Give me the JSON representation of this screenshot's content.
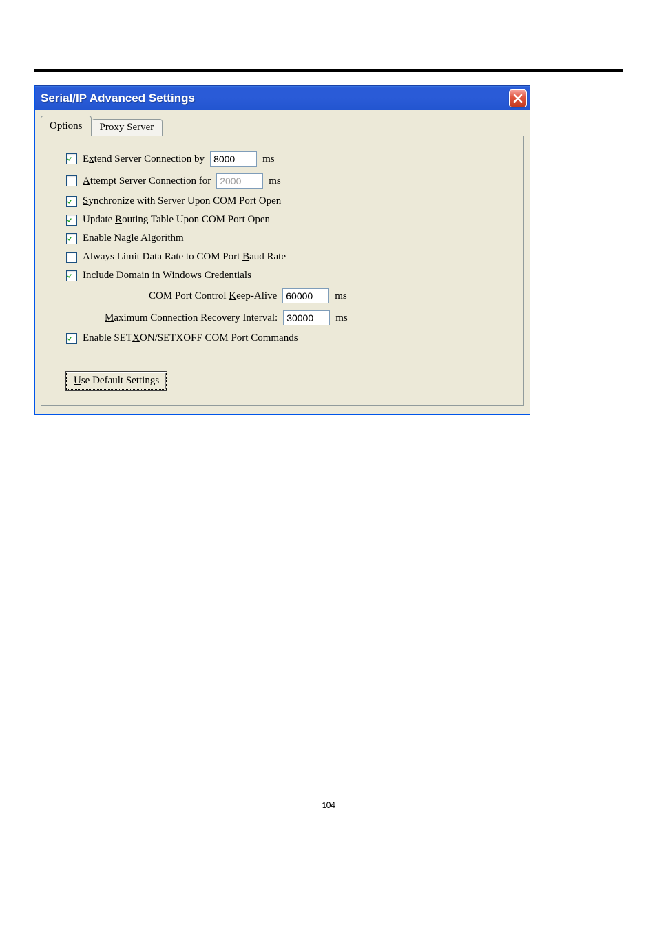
{
  "window": {
    "title": "Serial/IP Advanced Settings"
  },
  "tabs": {
    "options": "Options",
    "proxy": "Proxy Server"
  },
  "rows": {
    "extend": {
      "pre": "E",
      "u": "x",
      "post": "tend Server Connection by",
      "value": "8000",
      "unit": "ms"
    },
    "attempt": {
      "u": "A",
      "post": "ttempt Server Connection for",
      "value": "2000",
      "unit": "ms"
    },
    "sync": {
      "u": "S",
      "post": "ynchronize with Server Upon COM Port Open"
    },
    "routing": {
      "pre": "Update ",
      "u": "R",
      "post": "outing Table Upon COM Port Open"
    },
    "nagle": {
      "pre": "Enable ",
      "u": "N",
      "post": "agle Algorithm"
    },
    "limit": {
      "pre": "Always Limit Data Rate to COM Port ",
      "u": "B",
      "post": "aud Rate"
    },
    "domain": {
      "u": "I",
      "post": "nclude Domain in Windows Credentials"
    },
    "keepalive": {
      "pre": "COM Port Control ",
      "u": "K",
      "post": "eep-Alive",
      "value": "60000",
      "unit": "ms"
    },
    "recovery": {
      "u": "M",
      "post": "aximum Connection Recovery Interval:",
      "value": "30000",
      "unit": "ms"
    },
    "setxon": {
      "pre": "Enable SET",
      "u": "X",
      "post": "ON/SETXOFF COM Port Commands"
    }
  },
  "button": {
    "u": "U",
    "post": "se Default Settings"
  },
  "page_number": "104"
}
